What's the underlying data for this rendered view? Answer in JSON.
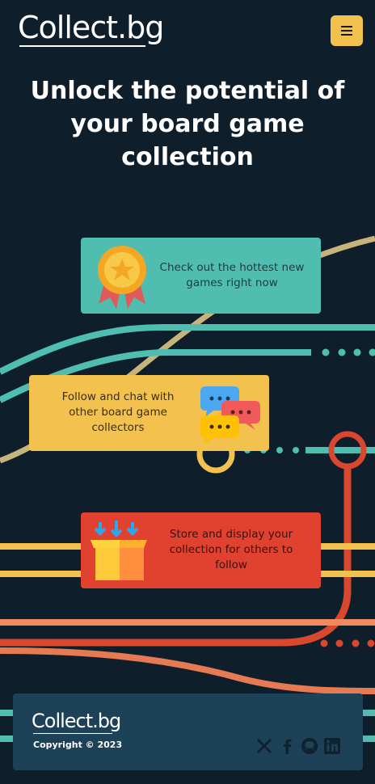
{
  "header": {
    "logo": "Collect.bg",
    "menu_icon": "hamburger-menu-icon"
  },
  "hero": {
    "title": "Unlock the potential of your board game collection"
  },
  "features": [
    {
      "text": "Check out the hottest new games right now",
      "icon": "medal-icon",
      "color": "#4fbeb0"
    },
    {
      "text": "Follow and chat with other board game collectors",
      "icon": "chat-bubbles-icon",
      "color": "#f2c14e"
    },
    {
      "text": "Store and display your collection for others to follow",
      "icon": "box-icon",
      "color": "#e0422f"
    }
  ],
  "footer": {
    "logo": "Collect.bg",
    "copyright": "Copyright © 2023",
    "socials": [
      "x-icon",
      "facebook-icon",
      "github-icon",
      "linkedin-icon"
    ]
  },
  "colors": {
    "background": "#0f1e2b",
    "teal": "#4fbeb0",
    "yellow": "#f2c14e",
    "red": "#e0422f",
    "footer": "#1d4257"
  }
}
